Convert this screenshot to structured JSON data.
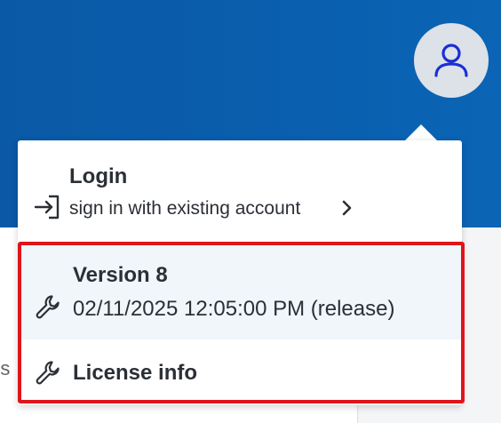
{
  "user_menu": {
    "login": {
      "title": "Login",
      "subtitle": "sign in with existing account",
      "icon": "login-arrow-icon"
    },
    "version": {
      "title": "Version 8",
      "build": "02/11/2025 12:05:00 PM (release)",
      "icon": "wrench-icon"
    },
    "license": {
      "label": "License info",
      "icon": "wrench-icon"
    }
  },
  "background": {
    "cut_off_text": "ts"
  },
  "colors": {
    "header": "#0a5fae",
    "avatar_bg": "#dde1e8",
    "avatar_icon": "#1a2fd6",
    "highlight": "#e0141b",
    "selected_row": "#f0f6fa",
    "text": "#2b2f36"
  }
}
